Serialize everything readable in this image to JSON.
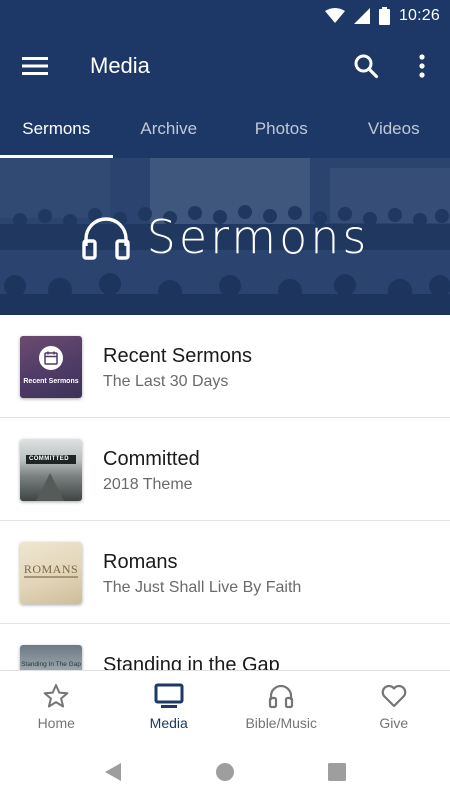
{
  "status_bar": {
    "time": "10:26"
  },
  "app_bar": {
    "title": "Media"
  },
  "tabs": [
    {
      "label": "Sermons",
      "active": true
    },
    {
      "label": "Archive",
      "active": false
    },
    {
      "label": "Photos",
      "active": false
    },
    {
      "label": "Videos",
      "active": false
    }
  ],
  "banner": {
    "title": "Sermons",
    "icon": "headphones-icon"
  },
  "list": [
    {
      "title": "Recent Sermons",
      "subtitle": "The Last 30 Days",
      "thumb_caption": "Recent Sermons"
    },
    {
      "title": "Committed",
      "subtitle": "2018 Theme",
      "thumb_caption": "COMMITTED"
    },
    {
      "title": "Romans",
      "subtitle": "The Just Shall Live By Faith",
      "thumb_caption": "ROMANS"
    },
    {
      "title": "Standing in the Gap",
      "subtitle": "",
      "thumb_caption": "Standing In The Gap"
    }
  ],
  "bottom_nav": [
    {
      "label": "Home",
      "icon": "star-icon",
      "active": false
    },
    {
      "label": "Media",
      "icon": "tv-icon",
      "active": true
    },
    {
      "label": "Bible/Music",
      "icon": "headphones-icon",
      "active": false
    },
    {
      "label": "Give",
      "icon": "heart-icon",
      "active": false
    }
  ],
  "colors": {
    "primary": "#1d3866",
    "inactive": "#757575",
    "text": "#1a1a1a",
    "subtext": "#6a6a6a"
  }
}
